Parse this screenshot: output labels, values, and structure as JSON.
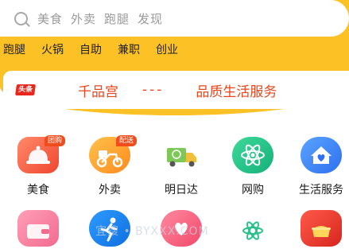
{
  "search": {
    "hint_words": [
      "美食",
      "外卖",
      "跑腿",
      "发现"
    ]
  },
  "hot_words": [
    "跑腿",
    "火锅",
    "自助",
    "兼职",
    "创业"
  ],
  "notice": {
    "tag": "头条",
    "text": "千品宫",
    "separator": "---",
    "text2": "品质生活服务"
  },
  "services_row1": [
    {
      "label": "美食",
      "badge": "团购",
      "icon": "cloche-icon"
    },
    {
      "label": "外卖",
      "badge": "配送",
      "icon": "delivery-scooter-icon"
    },
    {
      "label": "明日达",
      "icon": "truck-icon"
    },
    {
      "label": "网购",
      "icon": "atom-icon"
    },
    {
      "label": "生活服务",
      "icon": "home-heart-icon"
    }
  ],
  "services_row2": [
    {
      "icon": "wallet-icon"
    },
    {
      "icon": "runner-icon"
    },
    {
      "icon": "heart-hand-icon"
    },
    {
      "icon": "atom-small-icon"
    },
    {
      "icon": "gift-box-icon"
    }
  ],
  "watermark": "宜搜 • BYXXX.COM",
  "colors": {
    "brand": "#fcc125",
    "accent": "#e5471f"
  }
}
